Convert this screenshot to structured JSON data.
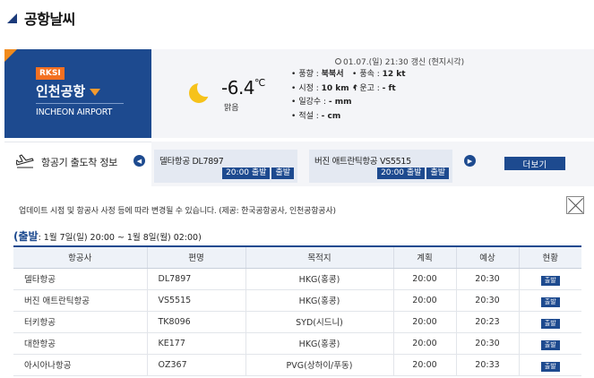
{
  "page": {
    "title": "공항날씨"
  },
  "airport": {
    "code": "RKSI",
    "name": "인천공항",
    "name_en": "INCHEON AIRPORT"
  },
  "weather": {
    "temperature": "-6.4",
    "unit": "℃",
    "condition": "맑음",
    "icon": "moon-icon",
    "update": "01.07.(일) 21:30 갱신 (현지시각)",
    "col1": [
      {
        "label": "풍향 : ",
        "value": "북북서"
      },
      {
        "label": "시정 : ",
        "value": "10 km ↑"
      },
      {
        "label": "일강수 : ",
        "value": "- mm"
      },
      {
        "label": "적설 : ",
        "value": "- cm"
      }
    ],
    "col2": [
      {
        "label": "풍속 : ",
        "value": "12 kt"
      },
      {
        "label": "운고 : ",
        "value": "- ft"
      }
    ]
  },
  "flight_bar": {
    "label": "항공기 출도착 정보",
    "cards": [
      {
        "name": "델타항공 DL7897",
        "time": "20:00 출발",
        "tag": "출발"
      },
      {
        "name": "버진 애트란틱항공 VS5515",
        "time": "20:00 출발",
        "tag": "출발"
      }
    ],
    "prev": "◀",
    "next": "▶",
    "more_label": "더보기"
  },
  "notice": "업데이트 시점 및 항공사 사정 등에 따라 변경될 수 있습니다. (제공: 한국공항공사, 인천공항공사)",
  "departures": {
    "title": "(출발",
    "range": ": 1월 7일(일) 20:00 ~ 1월 8일(월) 02:00)",
    "headers": [
      "항공사",
      "편명",
      "목적지",
      "계획",
      "예상",
      "현황"
    ],
    "rows": [
      {
        "airline": "델타항공",
        "flight": "DL7897",
        "dest": "HKG(홍콩)",
        "plan": "20:00",
        "expected": "20:30",
        "status": "출발"
      },
      {
        "airline": "버진 애트란틱항공",
        "flight": "VS5515",
        "dest": "HKG(홍콩)",
        "plan": "20:00",
        "expected": "20:30",
        "status": "출발"
      },
      {
        "airline": "터키항공",
        "flight": "TK8096",
        "dest": "SYD(시드니)",
        "plan": "20:00",
        "expected": "20:23",
        "status": "출발"
      },
      {
        "airline": "대한항공",
        "flight": "KE177",
        "dest": "HKG(홍콩)",
        "plan": "20:00",
        "expected": "20:30",
        "status": "출발"
      },
      {
        "airline": "아시아나항공",
        "flight": "OZ367",
        "dest": "PVG(상하이/푸동)",
        "plan": "20:00",
        "expected": "20:33",
        "status": "출발"
      }
    ]
  },
  "colors": {
    "navy": "#1d4a8f",
    "orange": "#f37021",
    "sun": "#f6c21a"
  }
}
